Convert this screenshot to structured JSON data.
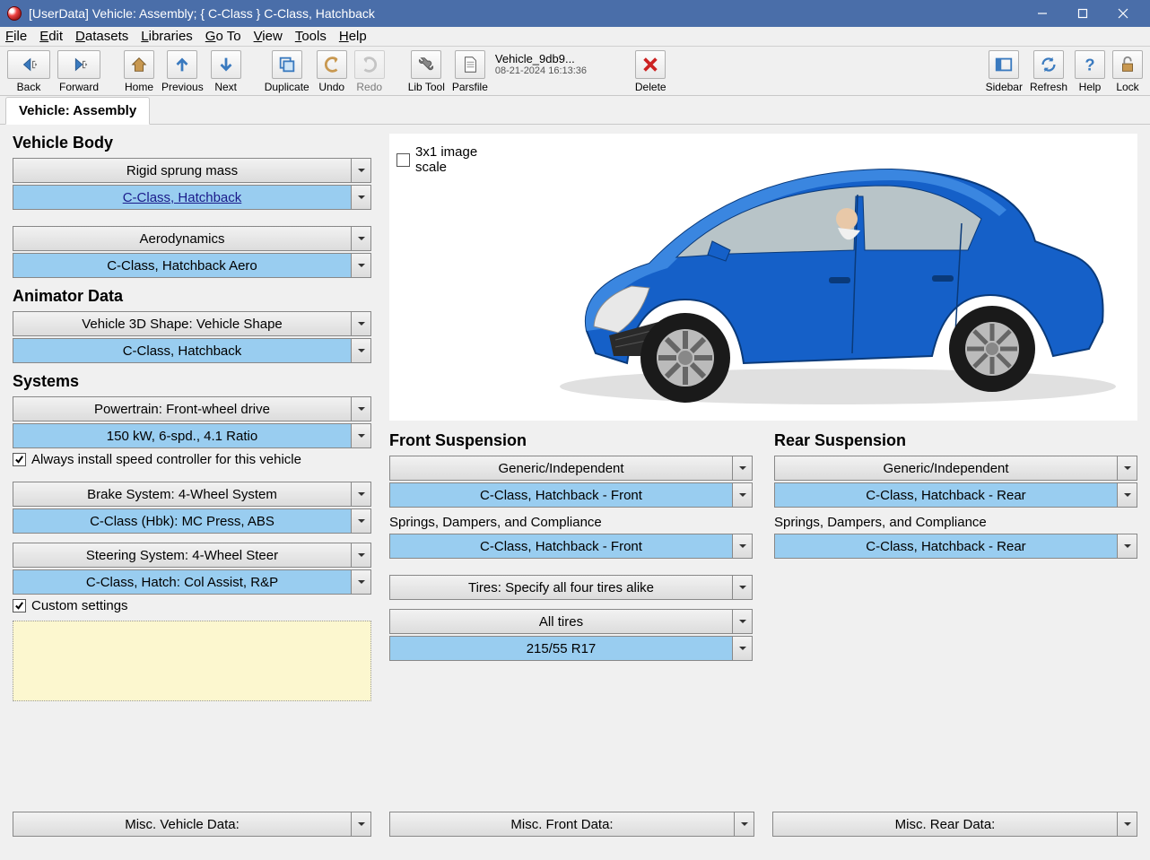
{
  "titlebar": {
    "title": "[UserData] Vehicle: Assembly; { C-Class } C-Class, Hatchback"
  },
  "menu": {
    "file": "File",
    "edit": "Edit",
    "datasets": "Datasets",
    "libraries": "Libraries",
    "goto": "Go To",
    "view": "View",
    "tools": "Tools",
    "help": "Help"
  },
  "toolbar": {
    "back": "Back",
    "forward": "Forward",
    "home": "Home",
    "previous": "Previous",
    "next": "Next",
    "duplicate": "Duplicate",
    "undo": "Undo",
    "redo": "Redo",
    "libtool": "Lib Tool",
    "parsfile": "Parsfile",
    "delete": "Delete",
    "sidebar": "Sidebar",
    "refresh": "Refresh",
    "help": "Help",
    "lock": "Lock",
    "file_name": "Vehicle_9db9...",
    "file_date": "08-21-2024 16:13:36"
  },
  "tab": {
    "label": "Vehicle: Assembly"
  },
  "left": {
    "vehicle_body_h": "Vehicle Body",
    "rigid": "Rigid sprung mass",
    "rigid_val": "C-Class, Hatchback",
    "aero": "Aerodynamics",
    "aero_val": "C-Class, Hatchback Aero",
    "animator_h": "Animator Data",
    "shape": "Vehicle 3D Shape: Vehicle Shape",
    "shape_val": "C-Class, Hatchback",
    "systems_h": "Systems",
    "powertrain": "Powertrain: Front-wheel drive",
    "powertrain_val": "150 kW, 6-spd., 4.1 Ratio",
    "speed_ctrl": "Always install speed controller for this vehicle",
    "brake": "Brake System: 4-Wheel System",
    "brake_val": "C-Class (Hbk): MC Press, ABS",
    "steer": "Steering System: 4-Wheel Steer",
    "steer_val": "C-Class, Hatch: Col Assist, R&P",
    "custom": "Custom settings",
    "misc": "Misc. Vehicle Data:"
  },
  "preview": {
    "scale": "3x1 image scale"
  },
  "front": {
    "h": "Front Suspension",
    "type": "Generic/Independent",
    "val": "C-Class, Hatchback - Front",
    "sdc": "Springs, Dampers, and Compliance",
    "sdc_val": "C-Class, Hatchback - Front"
  },
  "rear": {
    "h": "Rear Suspension",
    "type": "Generic/Independent",
    "val": "C-Class, Hatchback - Rear",
    "sdc": "Springs, Dampers, and Compliance",
    "sdc_val": "C-Class, Hatchback - Rear"
  },
  "tires": {
    "spec": "Tires: Specify all four tires alike",
    "all": "All tires",
    "size": "215/55 R17"
  },
  "bottom": {
    "front": "Misc. Front Data:",
    "rear": "Misc. Rear Data:"
  }
}
